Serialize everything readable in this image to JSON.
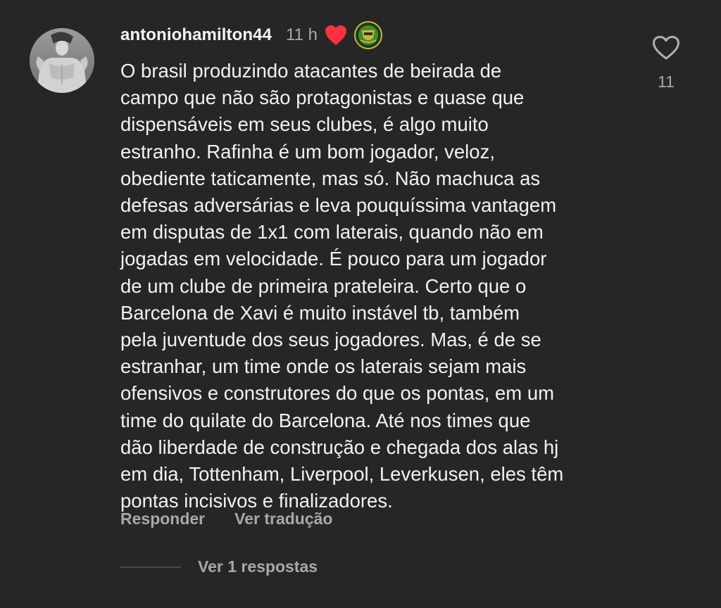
{
  "comment": {
    "username": "antoniohamilton44",
    "time": "11 h",
    "text": "O brasil produzindo atacantes de beirada de\ncampo que não são protagonistas e quase que\ndispensáveis em seus clubes, é algo muito\nestranho. Rafinha é um bom jogador, veloz,\nobediente taticamente, mas só. Não machuca as\ndefesas adversárias e leva pouquíssima vantagem\nem disputas de 1x1 com laterais, quando não em\njogadas em velocidade. É pouco para um jogador\nde um clube de primeira prateleira. Certo que o\nBarcelona de Xavi é muito instável tb, também\npela juventude dos seus jogadores. Mas, é de se\nestranhar, um time onde os laterais sejam mais\nofensivos e construtores do que os pontas, em um\ntime do quilate do Barcelona. Até nos times que\ndão liberdade de construção e chegada dos alas hj\nem dia, Tottenham, Liverpool, Leverkusen, eles têm\npontas incisivos e finalizadores.",
    "like_count": "11",
    "reply_label": "Responder",
    "translate_label": "Ver tradução",
    "view_replies_label": "Ver 1 respostas"
  },
  "icons": {
    "like": "heart-outline-icon",
    "creator_heart": "heart-filled-icon",
    "badge": "team-badge-icon"
  },
  "colors": {
    "background": "#262626",
    "text": "#f5f5f5",
    "muted": "#a8a8a8",
    "heart": "#ff3040",
    "badge_green": "#3a8f2e",
    "badge_gold": "#d4b436"
  }
}
